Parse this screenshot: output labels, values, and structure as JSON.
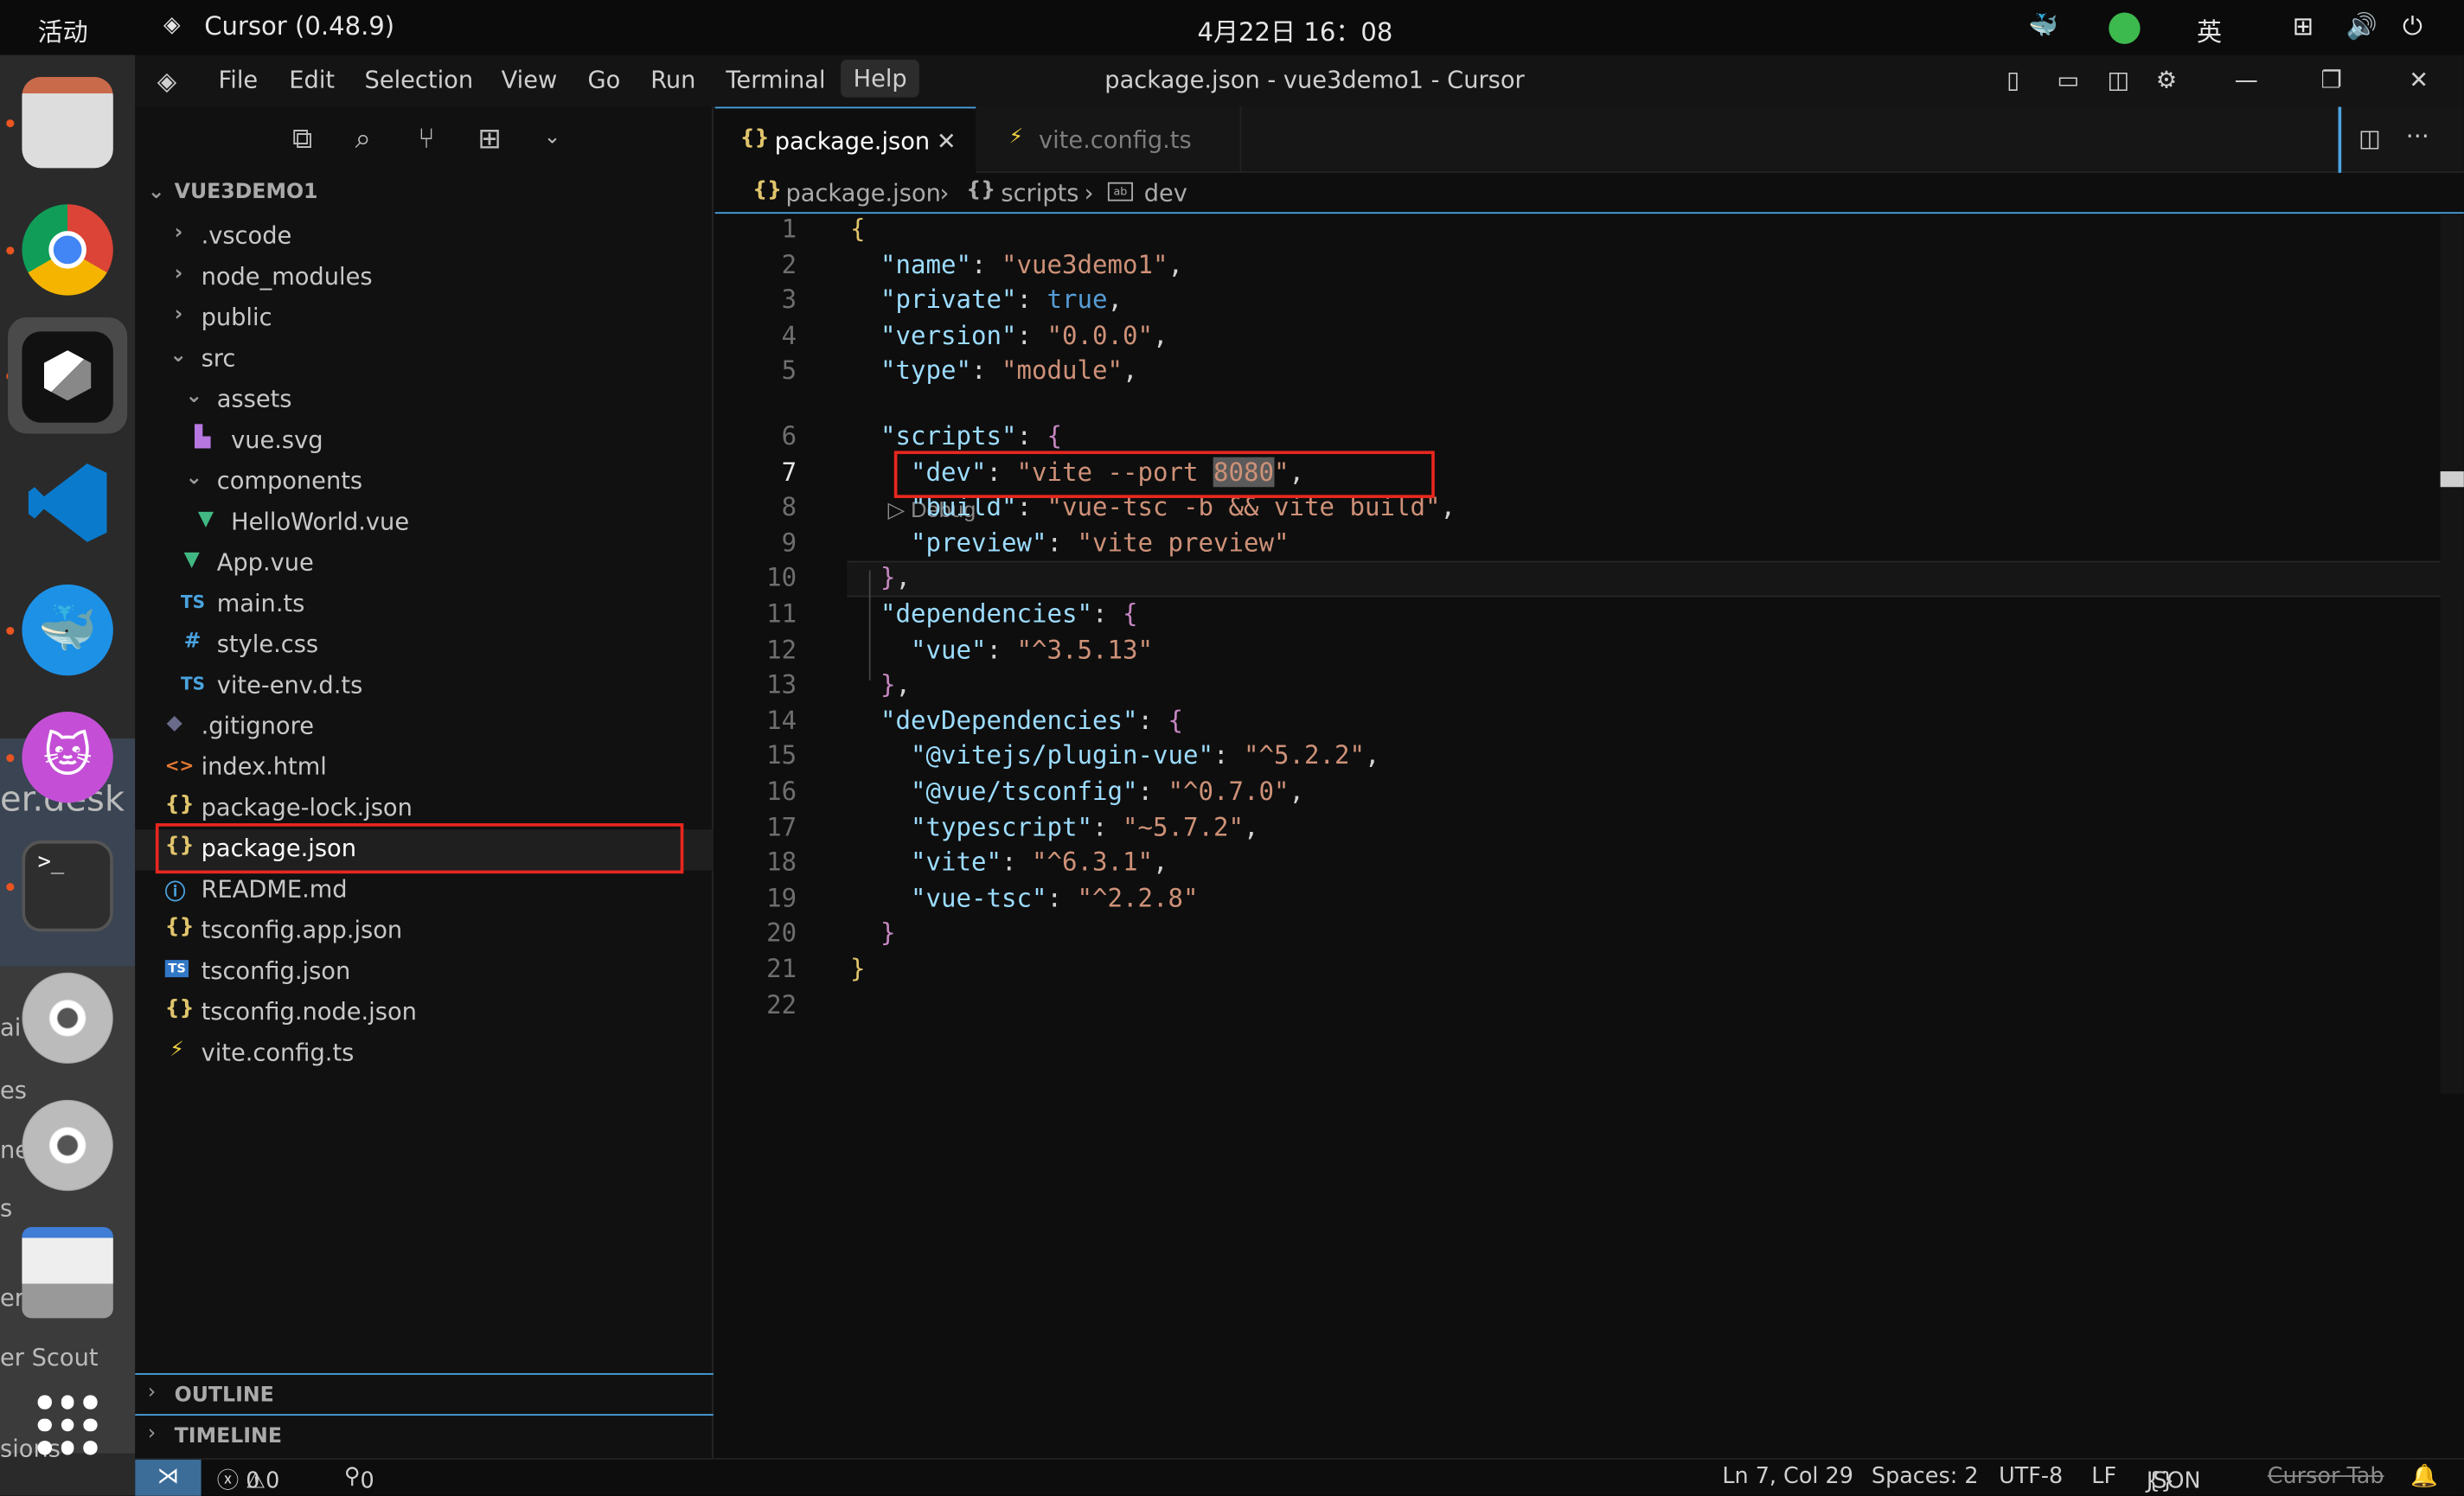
{
  "system_bar": {
    "activities": "活动",
    "app_name": "Cursor (0.48.9)",
    "clock": "4月22日  16：08",
    "input_method": "英"
  },
  "window": {
    "title": "package.json - vue3demo1 - Cursor",
    "menu": [
      "File",
      "Edit",
      "Selection",
      "View",
      "Go",
      "Run",
      "Terminal",
      "Help"
    ]
  },
  "dock": {
    "apps": [
      "files-app",
      "chrome-app",
      "cursor-app",
      "vscode-app",
      "docker-app",
      "cat-app",
      "terminal-app",
      "disc-1",
      "disc-2",
      "save-app",
      "show-apps"
    ],
    "bleed_text": [
      "er.desk",
      "ai",
      "es",
      "ne",
      "s",
      "er",
      "er Scout",
      "sions"
    ]
  },
  "explorer": {
    "project_name": "VUE3DEMO1",
    "items": [
      {
        "label": ".vscode",
        "type": "folder-closed"
      },
      {
        "label": "node_modules",
        "type": "folder-closed"
      },
      {
        "label": "public",
        "type": "folder-closed"
      },
      {
        "label": "src",
        "type": "folder-open"
      },
      {
        "label": "assets",
        "type": "folder-open"
      },
      {
        "label": "vue.svg",
        "type": "svg"
      },
      {
        "label": "components",
        "type": "folder-open"
      },
      {
        "label": "HelloWorld.vue",
        "type": "vue"
      },
      {
        "label": "App.vue",
        "type": "vue"
      },
      {
        "label": "main.ts",
        "type": "ts",
        "icon_text": "TS"
      },
      {
        "label": "style.css",
        "type": "css",
        "icon_text": "#"
      },
      {
        "label": "vite-env.d.ts",
        "type": "ts",
        "icon_text": "TS"
      },
      {
        "label": ".gitignore",
        "type": "git"
      },
      {
        "label": "index.html",
        "type": "html",
        "icon_text": "<>"
      },
      {
        "label": "package-lock.json",
        "type": "json",
        "icon_text": "{}"
      },
      {
        "label": "package.json",
        "type": "json",
        "icon_text": "{}"
      },
      {
        "label": "README.md",
        "type": "info",
        "icon_text": "ⓘ"
      },
      {
        "label": "tsconfig.app.json",
        "type": "json",
        "icon_text": "{}"
      },
      {
        "label": "tsconfig.json",
        "type": "tsconfig",
        "icon_text": "TS"
      },
      {
        "label": "tsconfig.node.json",
        "type": "json",
        "icon_text": "{}"
      },
      {
        "label": "vite.config.ts",
        "type": "vite",
        "icon_text": "⚡"
      }
    ],
    "outline_label": "OUTLINE",
    "timeline_label": "TIMELINE"
  },
  "tabs": [
    {
      "label": "package.json",
      "icon_text": "{}",
      "active": true
    },
    {
      "label": "vite.config.ts",
      "icon_text": "⚡",
      "active": false
    }
  ],
  "breadcrumb": {
    "file": "package.json",
    "file_icon": "{}",
    "section": "scripts",
    "section_icon": "{}",
    "leaf": "dev"
  },
  "codelens": "Debug",
  "code_lines": [
    {
      "n": "1",
      "html": "<span class='b'>{</span>"
    },
    {
      "n": "2",
      "html": "  <span class='k'>\"name\"</span><span class='p'>: </span><span class='s'>\"vue3demo1\"</span><span class='p'>,</span>"
    },
    {
      "n": "3",
      "html": "  <span class='k'>\"private\"</span><span class='p'>: </span><span class='kw'>true</span><span class='p'>,</span>"
    },
    {
      "n": "4",
      "html": "  <span class='k'>\"version\"</span><span class='p'>: </span><span class='s'>\"0.0.0\"</span><span class='p'>,</span>"
    },
    {
      "n": "5",
      "html": "  <span class='k'>\"type\"</span><span class='p'>: </span><span class='s'>\"module\"</span><span class='p'>,</span>"
    },
    {
      "n": "6",
      "html": "  <span class='k'>\"scripts\"</span><span class='p'>: </span><span class='br2'>{</span>"
    },
    {
      "n": "7",
      "html": "    <span class='k'>\"dev\"</span><span class='p'>: </span><span class='s'>\"vite --port <span style='background:#5a5a5a'>8080</span>\"</span><span class='p'>,</span>"
    },
    {
      "n": "8",
      "html": "    <span class='k'>\"build\"</span><span class='p'>: </span><span class='s'>\"vue-tsc -b &amp;&amp; vite build\"</span><span class='p'>,</span>"
    },
    {
      "n": "9",
      "html": "    <span class='k'>\"preview\"</span><span class='p'>: </span><span class='s'>\"vite preview\"</span>"
    },
    {
      "n": "10",
      "html": "  <span class='br2'>}</span><span class='p'>,</span>"
    },
    {
      "n": "11",
      "html": "  <span class='k'>\"dependencies\"</span><span class='p'>: </span><span class='br2'>{</span>"
    },
    {
      "n": "12",
      "html": "    <span class='k'>\"vue\"</span><span class='p'>: </span><span class='s'>\"^3.5.13\"</span>"
    },
    {
      "n": "13",
      "html": "  <span class='br2'>}</span><span class='p'>,</span>"
    },
    {
      "n": "14",
      "html": "  <span class='k'>\"devDependencies\"</span><span class='p'>: </span><span class='br2'>{</span>"
    },
    {
      "n": "15",
      "html": "    <span class='k'>\"@vitejs/plugin-vue\"</span><span class='p'>: </span><span class='s'>\"^5.2.2\"</span><span class='p'>,</span>"
    },
    {
      "n": "16",
      "html": "    <span class='k'>\"@vue/tsconfig\"</span><span class='p'>: </span><span class='s'>\"^0.7.0\"</span><span class='p'>,</span>"
    },
    {
      "n": "17",
      "html": "    <span class='k'>\"typescript\"</span><span class='p'>: </span><span class='s'>\"~5.7.2\"</span><span class='p'>,</span>"
    },
    {
      "n": "18",
      "html": "    <span class='k'>\"vite\"</span><span class='p'>: </span><span class='s'>\"^6.3.1\"</span><span class='p'>,</span>"
    },
    {
      "n": "19",
      "html": "    <span class='k'>\"vue-tsc\"</span><span class='p'>: </span><span class='s'>\"^2.2.8\"</span>"
    },
    {
      "n": "20",
      "html": "  <span class='br2'>}</span>"
    },
    {
      "n": "21",
      "html": "<span class='b'>}</span>"
    },
    {
      "n": "22",
      "html": ""
    }
  ],
  "status": {
    "errors": "0",
    "warnings": "0",
    "ports": "0",
    "position": "Ln 7, Col 29",
    "spaces": "Spaces: 2",
    "encoding": "UTF-8",
    "eol": "LF",
    "language": "JSON",
    "language_icon": "{}",
    "cursor_tab": "Cursor Tab"
  },
  "colors": {
    "accent": "#4aa3df",
    "highlight_box": "#e8271f"
  }
}
